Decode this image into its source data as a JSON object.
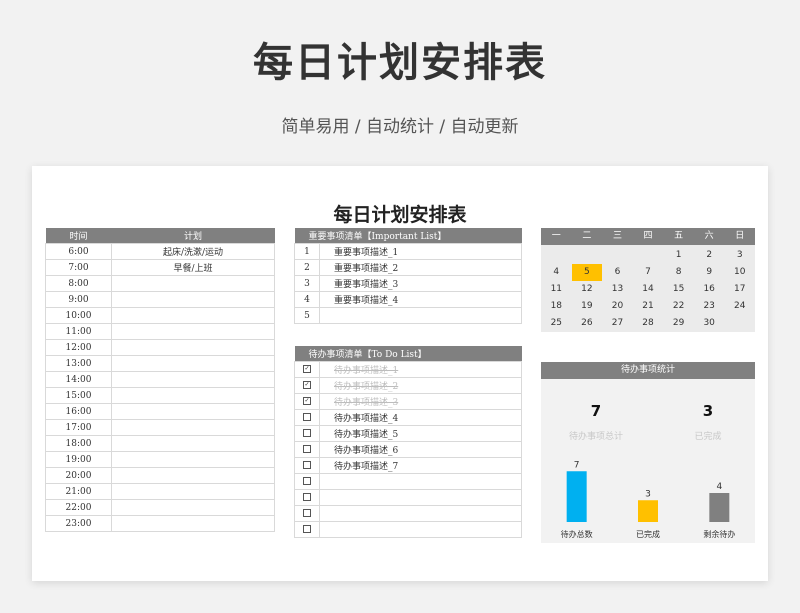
{
  "hero": {
    "title": "每日计划安排表",
    "subtitle": "简单易用 / 自动统计 / 自动更新"
  },
  "sheet_title": "每日计划安排表",
  "schedule": {
    "headers": [
      "时间",
      "计划"
    ],
    "rows": [
      [
        "6:00",
        "起床/洗漱/运动"
      ],
      [
        "7:00",
        "早餐/上班"
      ],
      [
        "8:00",
        ""
      ],
      [
        "9:00",
        ""
      ],
      [
        "10:00",
        ""
      ],
      [
        "11:00",
        ""
      ],
      [
        "12:00",
        ""
      ],
      [
        "13:00",
        ""
      ],
      [
        "14:00",
        ""
      ],
      [
        "15:00",
        ""
      ],
      [
        "16:00",
        ""
      ],
      [
        "17:00",
        ""
      ],
      [
        "18:00",
        ""
      ],
      [
        "19:00",
        ""
      ],
      [
        "20:00",
        ""
      ],
      [
        "21:00",
        ""
      ],
      [
        "22:00",
        ""
      ],
      [
        "23:00",
        ""
      ]
    ]
  },
  "important": {
    "header": "重要事项清单【Important List】",
    "items": [
      {
        "index": "1",
        "text": "重要事项描述_1"
      },
      {
        "index": "2",
        "text": "重要事项描述_2"
      },
      {
        "index": "3",
        "text": "重要事项描述_3"
      },
      {
        "index": "4",
        "text": "重要事项描述_4"
      },
      {
        "index": "5",
        "text": ""
      }
    ]
  },
  "todo": {
    "header": "待办事项清单【To Do List】",
    "items": [
      {
        "done": true,
        "text": "待办事项描述_1"
      },
      {
        "done": true,
        "text": "待办事项描述_2"
      },
      {
        "done": true,
        "text": "待办事项描述_3"
      },
      {
        "done": false,
        "text": "待办事项描述_4"
      },
      {
        "done": false,
        "text": "待办事项描述_5"
      },
      {
        "done": false,
        "text": "待办事项描述_6"
      },
      {
        "done": false,
        "text": "待办事项描述_7"
      },
      {
        "done": false,
        "text": ""
      },
      {
        "done": false,
        "text": ""
      },
      {
        "done": false,
        "text": ""
      },
      {
        "done": false,
        "text": ""
      }
    ]
  },
  "calendar": {
    "weekdays": [
      "一",
      "二",
      "三",
      "四",
      "五",
      "六",
      "日"
    ],
    "weeks": [
      [
        "",
        "",
        "",
        "",
        "1",
        "2",
        "3"
      ],
      [
        "4",
        "5",
        "6",
        "7",
        "8",
        "9",
        "10"
      ],
      [
        "11",
        "12",
        "13",
        "14",
        "15",
        "16",
        "17"
      ],
      [
        "18",
        "19",
        "20",
        "21",
        "22",
        "23",
        "24"
      ],
      [
        "25",
        "26",
        "27",
        "28",
        "29",
        "30",
        ""
      ]
    ],
    "today": "5",
    "highlight_color": "#ffc000"
  },
  "stats": {
    "header": "待办事项统计",
    "total_value": "7",
    "total_label": "待办事项总计",
    "done_value": "3",
    "done_label": "已完成"
  },
  "chart_data": {
    "type": "bar",
    "categories": [
      "待办总数",
      "已完成",
      "剩余待办"
    ],
    "values": [
      7,
      3,
      4
    ],
    "colors": [
      "#00b0f0",
      "#ffc000",
      "#808080"
    ],
    "ylim": [
      0,
      8
    ],
    "title": "",
    "xlabel": "",
    "ylabel": ""
  }
}
